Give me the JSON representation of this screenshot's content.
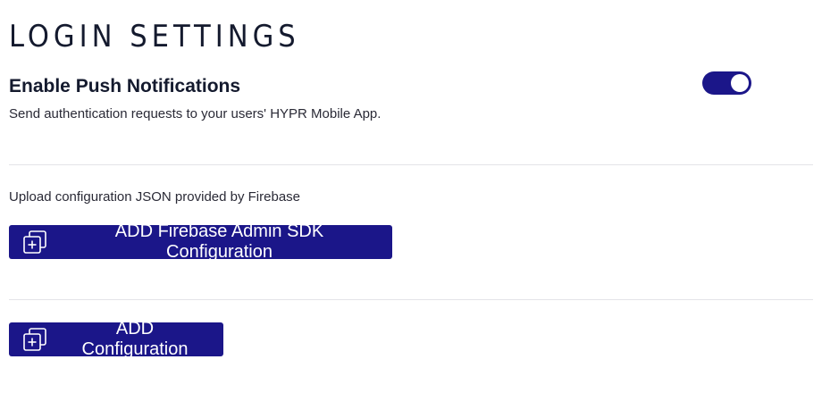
{
  "page": {
    "title": "LOGIN SETTINGS"
  },
  "push_notifications": {
    "heading": "Enable Push Notifications",
    "description": "Send authentication requests to your users' HYPR Mobile App.",
    "enabled": true
  },
  "firebase": {
    "upload_label": "Upload configuration JSON provided by Firebase",
    "add_button_label": "ADD Firebase Admin SDK Configuration",
    "add_button_icon": "add-copy-icon"
  },
  "configuration": {
    "add_button_label": "ADD Configuration",
    "add_button_icon": "add-copy-icon"
  },
  "colors": {
    "accent": "#1b1689",
    "text": "#141a2e",
    "divider": "#e4e4e8"
  }
}
